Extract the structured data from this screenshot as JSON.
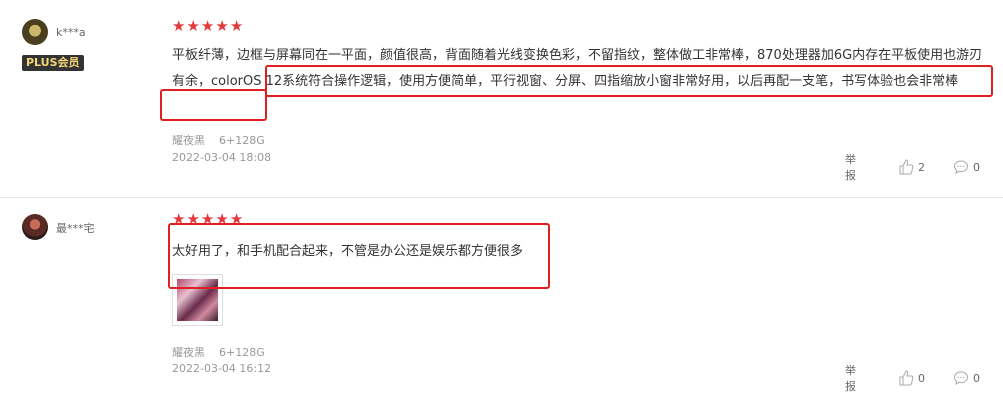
{
  "reviews": [
    {
      "username": "k***a",
      "badge": "PLUS会员",
      "stars": [
        "★",
        "★",
        "★",
        "★",
        "★"
      ],
      "content": "平板纤薄，边框与屏幕同在一平面，颜值很高，背面随着光线变换色彩，不留指纹，整体做工非常棒，870处理器加6G内存在平板使用也游刃有余，colorOS 12系统符合操作逻辑，使用方便简单，平行视窗、分屏、四指缩放小窗非常好用，以后再配一支笔，书写体验也会非常棒",
      "color_label": "耀夜黑",
      "spec": "6+128G",
      "datetime": "2022-03-04 18:08",
      "report_label": "举报",
      "like_count": "2",
      "comment_count": "0"
    },
    {
      "username": "最***宅",
      "stars": [
        "★",
        "★",
        "★",
        "★",
        "★"
      ],
      "content": "太好用了，和手机配合起来，不管是办公还是娱乐都方便很多",
      "color_label": "耀夜黑",
      "spec": "6+128G",
      "datetime": "2022-03-04 16:12",
      "report_label": "举报",
      "like_count": "0",
      "comment_count": "0"
    }
  ],
  "colors": {
    "star": "#e4393c",
    "highlight": "#e02020",
    "plus_badge_bg": "#333333",
    "plus_badge_text": "#f5d67b"
  },
  "icons": {
    "like": "thumbs-up-icon",
    "comment": "comment-icon"
  }
}
